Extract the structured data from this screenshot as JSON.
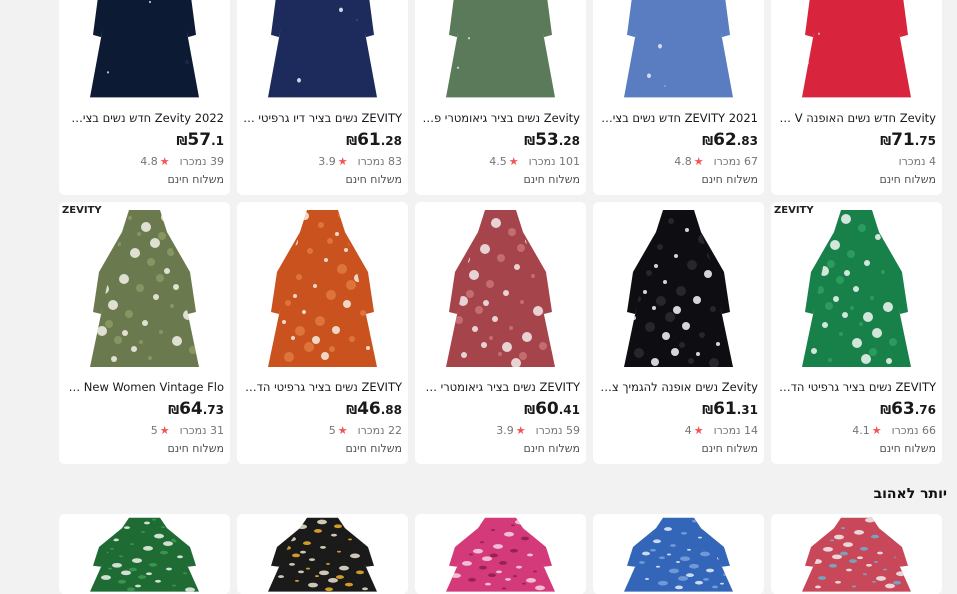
{
  "currency": "₪",
  "row1": [
    {
      "title": "Zevity 2022 חדש נשים בציר גרפי…",
      "price_int": "57",
      "price_dec": ".1",
      "sold": "39 נמכרו",
      "rating": "4.8",
      "shipping": "משלוח חינם",
      "colors": [
        "#0d1a33",
        "#e9eef2",
        "#1e2a4a"
      ]
    },
    {
      "title": "ZEVITY נשים בציר דיו גרפיטי הדפ…",
      "price_int": "61",
      "price_dec": ".28",
      "sold": "83 נמכרו",
      "rating": "3.9",
      "shipping": "משלוח חינם",
      "colors": [
        "#1d2a5c",
        "#f0f2f7",
        "#3a4d8a"
      ]
    },
    {
      "title": "Zevity נשים בציר גיאומטרי פרחוני …",
      "price_int": "53",
      "price_dec": ".28",
      "sold": "101 נמכרו",
      "rating": "4.5",
      "shipping": "משלוח חינם",
      "colors": [
        "#5b7a5a",
        "#e6eee0",
        "#8fa88a"
      ]
    },
    {
      "title": "ZEVITY 2021 חדש נשים בציר כחו…",
      "price_int": "62",
      "price_dec": ".83",
      "sold": "67 נמכרו",
      "rating": "4.8",
      "shipping": "משלוח חינם",
      "colors": [
        "#5a7cc0",
        "#e8eef8",
        "#8aa4d8"
      ]
    },
    {
      "title": "Zevity חדש נשים האופנה V צוואר …",
      "price_int": "71",
      "price_dec": ".75",
      "sold": "4 נמכרו",
      "rating": "",
      "shipping": "משלוח חינם",
      "colors": [
        "#d8243c",
        "#f3c9d2",
        "#e79aac"
      ]
    }
  ],
  "row2": [
    {
      "title": "vity New Women Vintage Flo…",
      "price_int": "64",
      "price_dec": ".73",
      "sold": "31 נמכרו",
      "rating": "5",
      "shipping": "משלוח חינם",
      "brand": "ZEVITY",
      "colors": [
        "#6b7a4e",
        "#f4f2ea",
        "#8c9a66"
      ]
    },
    {
      "title": "ZEVITY נשים בציר גרפיטי הדפסה מ…",
      "price_int": "46",
      "price_dec": ".88",
      "sold": "22 נמכרו",
      "rating": "5",
      "shipping": "משלוח חינם",
      "brand": "",
      "colors": [
        "#c9521e",
        "#f6efe6",
        "#e07a3e"
      ]
    },
    {
      "title": "ZEVITY נשים בציר גיאומטרי הדפס…",
      "price_int": "60",
      "price_dec": ".41",
      "sold": "59 נמכרו",
      "rating": "3.9",
      "shipping": "משלוח חינם",
      "brand": "",
      "colors": [
        "#a5444a",
        "#f3ecec",
        "#c97478"
      ]
    },
    {
      "title": "Zevity נשים אופנה להגמיך צווארון …",
      "price_int": "61",
      "price_dec": ".31",
      "sold": "14 נמכרו",
      "rating": "4",
      "shipping": "משלוח חינם",
      "brand": "",
      "colors": [
        "#0e0e12",
        "#f8f8f8",
        "#2a2a30"
      ]
    },
    {
      "title": "ZEVITY נשים בציר גרפיטי הדפסת …",
      "price_int": "63",
      "price_dec": ".76",
      "sold": "66 נמכרו",
      "rating": "4.1",
      "shipping": "משלוח חינם",
      "brand": "ZEVITY",
      "colors": [
        "#18814a",
        "#f4f8f4",
        "#2fa062"
      ]
    }
  ],
  "section": {
    "title": "יותר לאהוב"
  },
  "row3": [
    {
      "colors": [
        "#1f6b34",
        "#f1f5ef",
        "#3f9a55"
      ]
    },
    {
      "colors": [
        "#1a1a1a",
        "#f1b32a",
        "#efe6cf"
      ]
    },
    {
      "colors": [
        "#d43a7a",
        "#f6d6e3",
        "#8a1f4a"
      ]
    },
    {
      "colors": [
        "#3366b8",
        "#e7eef9",
        "#7aa1dc"
      ]
    },
    {
      "colors": [
        "#c8485a",
        "#f0f0f0",
        "#6ab0d4"
      ]
    }
  ]
}
